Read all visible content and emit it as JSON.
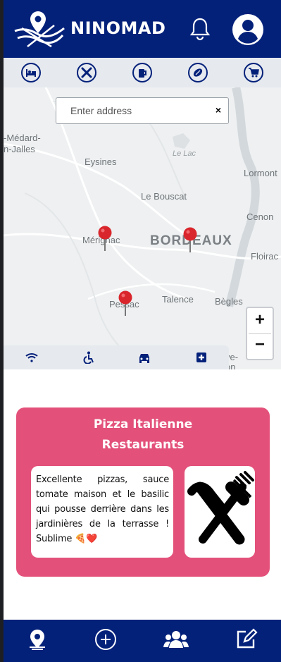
{
  "app": {
    "brand": "NINOMAD"
  },
  "header": {
    "icons": [
      "nomad-logo",
      "bell-icon",
      "user-avatar-icon"
    ]
  },
  "categories": [
    "bed-icon",
    "restaurant-icon",
    "beer-icon",
    "sport-ball-icon",
    "cart-icon"
  ],
  "search": {
    "placeholder": "Enter address",
    "value": "",
    "clear": "×"
  },
  "map": {
    "labels": [
      "-Médard-",
      "n-Jalles",
      "Eysines",
      "Le Lac",
      "Lormont",
      "Le Bouscat",
      "Cenon",
      "Mérignac",
      "BORDEAUX",
      "Floirac",
      "Pessac",
      "Talence",
      "Bègles",
      "ve-",
      "on"
    ],
    "markers": [
      "Mérignac",
      "Bordeaux",
      "Pessac"
    ],
    "zoom_in": "+",
    "zoom_out": "−"
  },
  "amenities": [
    "wifi-icon",
    "wheelchair-icon",
    "car-icon",
    "first-aid-icon"
  ],
  "place": {
    "name": "Pizza Italienne",
    "category": "Restaurants",
    "review": "Excellente pizzas, sauce tomate maison et le basilic qui pousse derrière dans les jardinières de la terrasse ! Sublime 🍕❤️",
    "icon": "restaurant-icon",
    "accent": "#e3517a"
  },
  "bottom_nav": [
    "map-pin-icon",
    "add-circle-icon",
    "users-icon",
    "edit-icon"
  ],
  "colors": {
    "primary": "#04217a",
    "accent": "#e3517a",
    "bar": "#e6e9ee"
  }
}
